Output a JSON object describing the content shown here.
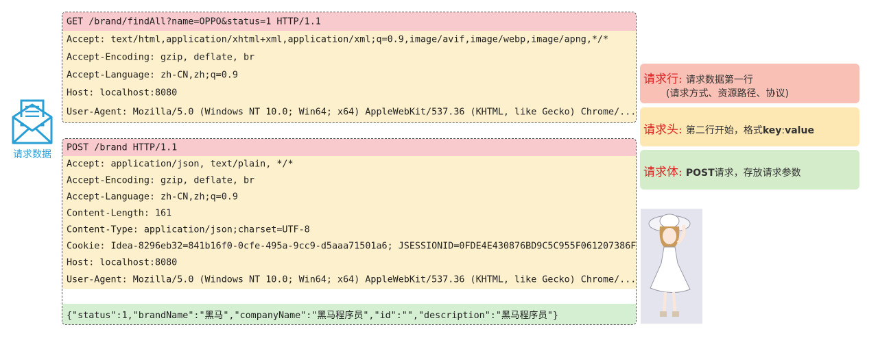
{
  "icon": {
    "name": "envelope-icon",
    "label": "请求数据",
    "color": "#2a9fd6"
  },
  "get_request": {
    "request_line": "GET /brand/findAll?name=OPPO&status=1 HTTP/1.1",
    "headers": [
      "Accept: text/html,application/xhtml+xml,application/xml;q=0.9,image/avif,image/webp,image/apng,*/*",
      "Accept-Encoding: gzip, deflate, br",
      "Accept-Language: zh-CN,zh;q=0.9",
      "Host: localhost:8080",
      "User-Agent: Mozilla/5.0 (Windows NT 10.0; Win64; x64) AppleWebKit/537.36 (KHTML, like Gecko) Chrome/..."
    ]
  },
  "post_request": {
    "request_line": "POST /brand HTTP/1.1",
    "headers": [
      "Accept: application/json, text/plain, */*",
      "Accept-Encoding: gzip, deflate, br",
      "Accept-Language: zh-CN,zh;q=0.9",
      "Content-Length: 161",
      "Content-Type: application/json;charset=UTF-8",
      "Cookie: Idea-8296eb32=841b16f0-0cfe-495a-9cc9-d5aaa71501a6; JSESSIONID=0FDE4E430876BD9C5C955F061207386F",
      "Host: localhost:8080",
      "User-Agent: Mozilla/5.0 (Windows NT 10.0; Win64; x64) AppleWebKit/537.36 (KHTML, like Gecko) Chrome/..."
    ],
    "body": "{\"status\":1,\"brandName\":\"黑马\",\"companyName\":\"黑马程序员\",\"id\":\"\",\"description\":\"黑马程序员\"}"
  },
  "legend": {
    "request_line": {
      "title": "请求行:",
      "desc1": "请求数据第一行",
      "desc2": "(请求方式、资源路径、协议)"
    },
    "request_header": {
      "title": "请求头:",
      "desc_pre": "第二行开始，格式",
      "desc_key": "key",
      "desc_sep": ":",
      "desc_value": "value"
    },
    "request_body": {
      "title": "请求体:",
      "desc_post": "POST",
      "desc_rest": "请求，存放请求参数"
    }
  },
  "colors": {
    "request_line": "#f8c9cd",
    "request_header": "#fdf0cc",
    "request_body": "#d5efd2",
    "legend_line": "#f9c0b6",
    "legend_header": "#fde7b3",
    "legend_body": "#d4ecc9",
    "accent_red": "#e02020",
    "icon_blue": "#2a9fd6"
  }
}
